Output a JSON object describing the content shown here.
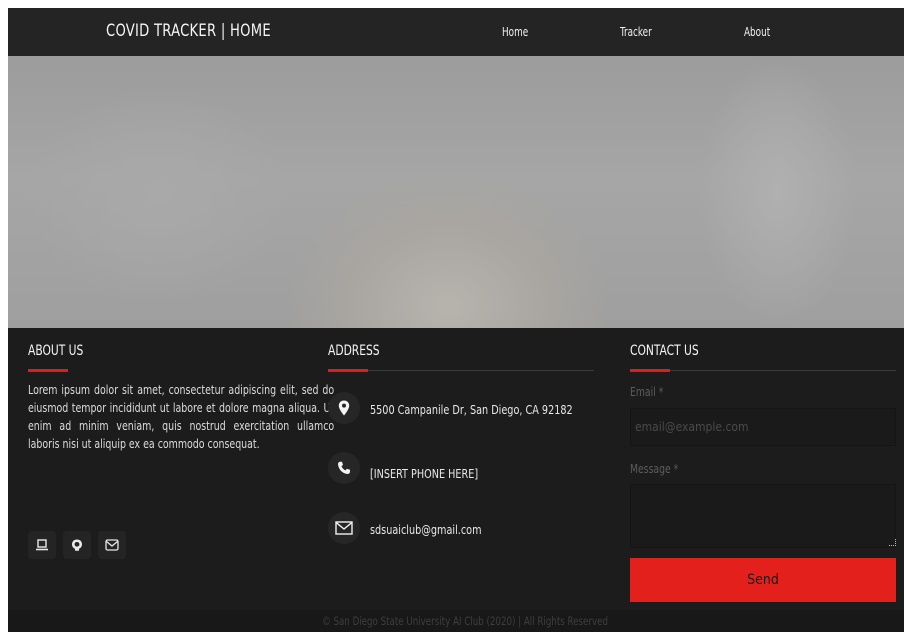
{
  "navbar": {
    "brand": "COVID TRACKER | HOME",
    "links": [
      "Home",
      "Tracker",
      "About"
    ]
  },
  "about": {
    "title": "ABOUT US",
    "text": "Lorem ipsum dolor sit amet, consectetur adipiscing elit, sed do eiusmod tempor incididunt ut labore et dolore magna aliqua. Ut enim ad minim veniam, quis nostrud exercitation ullamco laboris nisi ut aliquip ex ea commodo consequat.",
    "social_icons": [
      "laptop-icon",
      "github-icon",
      "mail-icon"
    ]
  },
  "address": {
    "title": "ADDRESS",
    "location": "5500 Campanile Dr, San Diego, CA 92182",
    "phone": "[INSERT PHONE HERE]",
    "email": "sdsuaiclub@gmail.com"
  },
  "contact": {
    "title": "CONTACT US",
    "email_label": "Email *",
    "email_placeholder": "email@example.com",
    "message_label": "Message *",
    "send_label": "Send"
  },
  "footer": {
    "copyright": "© San Diego State University AI Club (2020) | All Rights Reserved"
  },
  "colors": {
    "accent": "#e4201d",
    "background": "#1c1c1c",
    "navbar": "#242424"
  }
}
